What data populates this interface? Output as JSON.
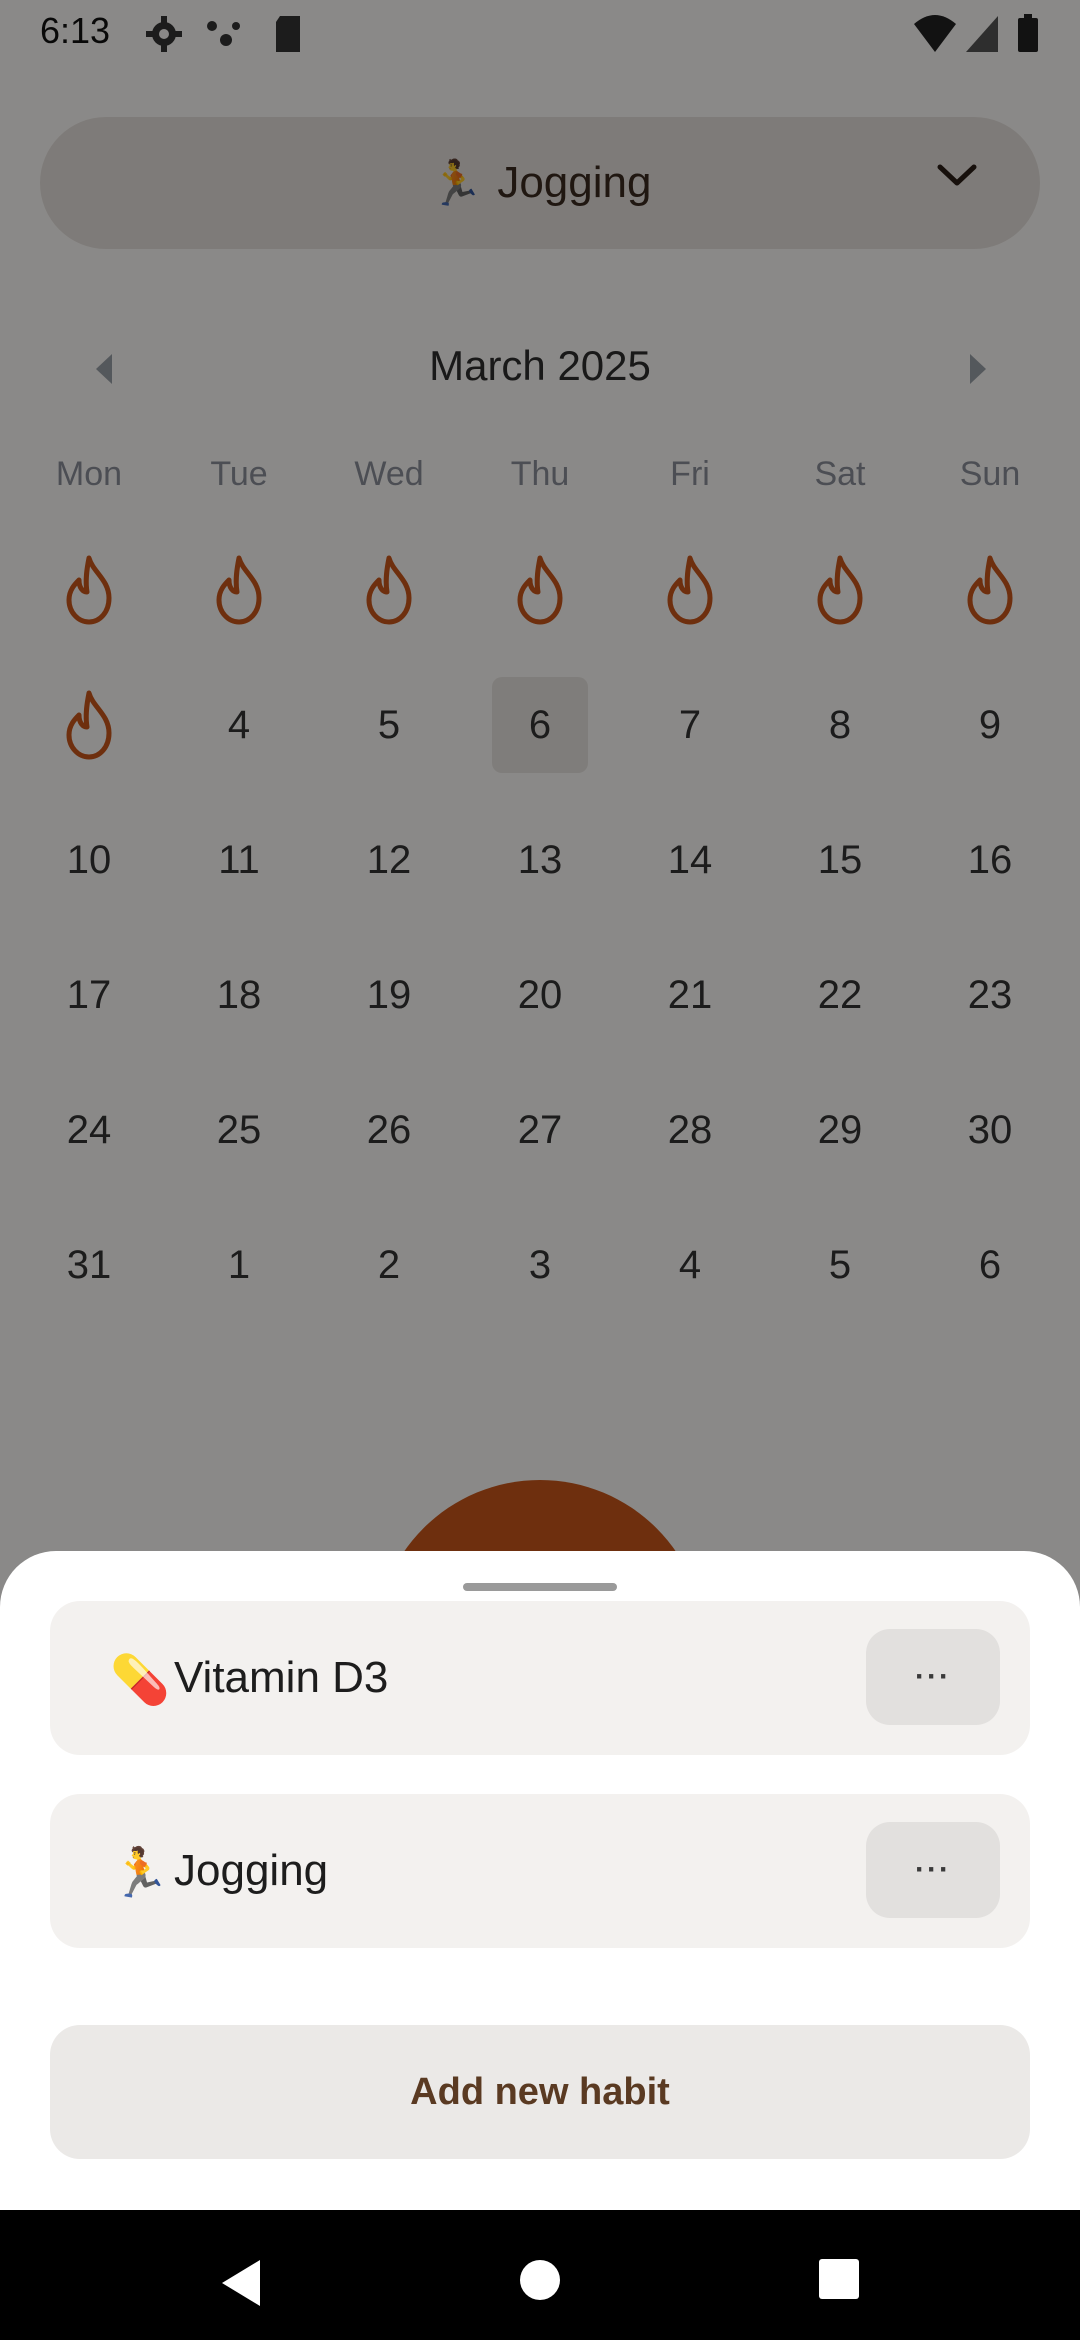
{
  "status_bar": {
    "time": "6:13",
    "icons": [
      "settings-icon",
      "dots-icon",
      "sd-card-icon",
      "wifi-icon",
      "signal-icon",
      "battery-icon"
    ]
  },
  "selector": {
    "emoji": "🏃",
    "label": "Jogging",
    "chevron": "chevron-down-icon"
  },
  "calendar": {
    "month_label": "March 2025",
    "weekdays": [
      "Mon",
      "Tue",
      "Wed",
      "Thu",
      "Fri",
      "Sat",
      "Sun"
    ],
    "rows": [
      [
        "",
        "",
        "",
        "",
        "",
        "",
        ""
      ],
      [
        "",
        "4",
        "5",
        "6",
        "7",
        "8",
        "9"
      ],
      [
        "10",
        "11",
        "12",
        "13",
        "14",
        "15",
        "16"
      ],
      [
        "17",
        "18",
        "19",
        "20",
        "21",
        "22",
        "23"
      ],
      [
        "24",
        "25",
        "26",
        "27",
        "28",
        "29",
        "30"
      ],
      [
        "31",
        "1",
        "2",
        "3",
        "4",
        "5",
        "6"
      ]
    ],
    "accent": "#c8561a"
  },
  "sheet": {
    "habits": [
      {
        "emoji": "💊",
        "name": "Vitamin D3",
        "more": "···"
      },
      {
        "emoji": "🏃",
        "name": "Jogging",
        "more": "···"
      }
    ],
    "add_label": "Add new habit"
  }
}
